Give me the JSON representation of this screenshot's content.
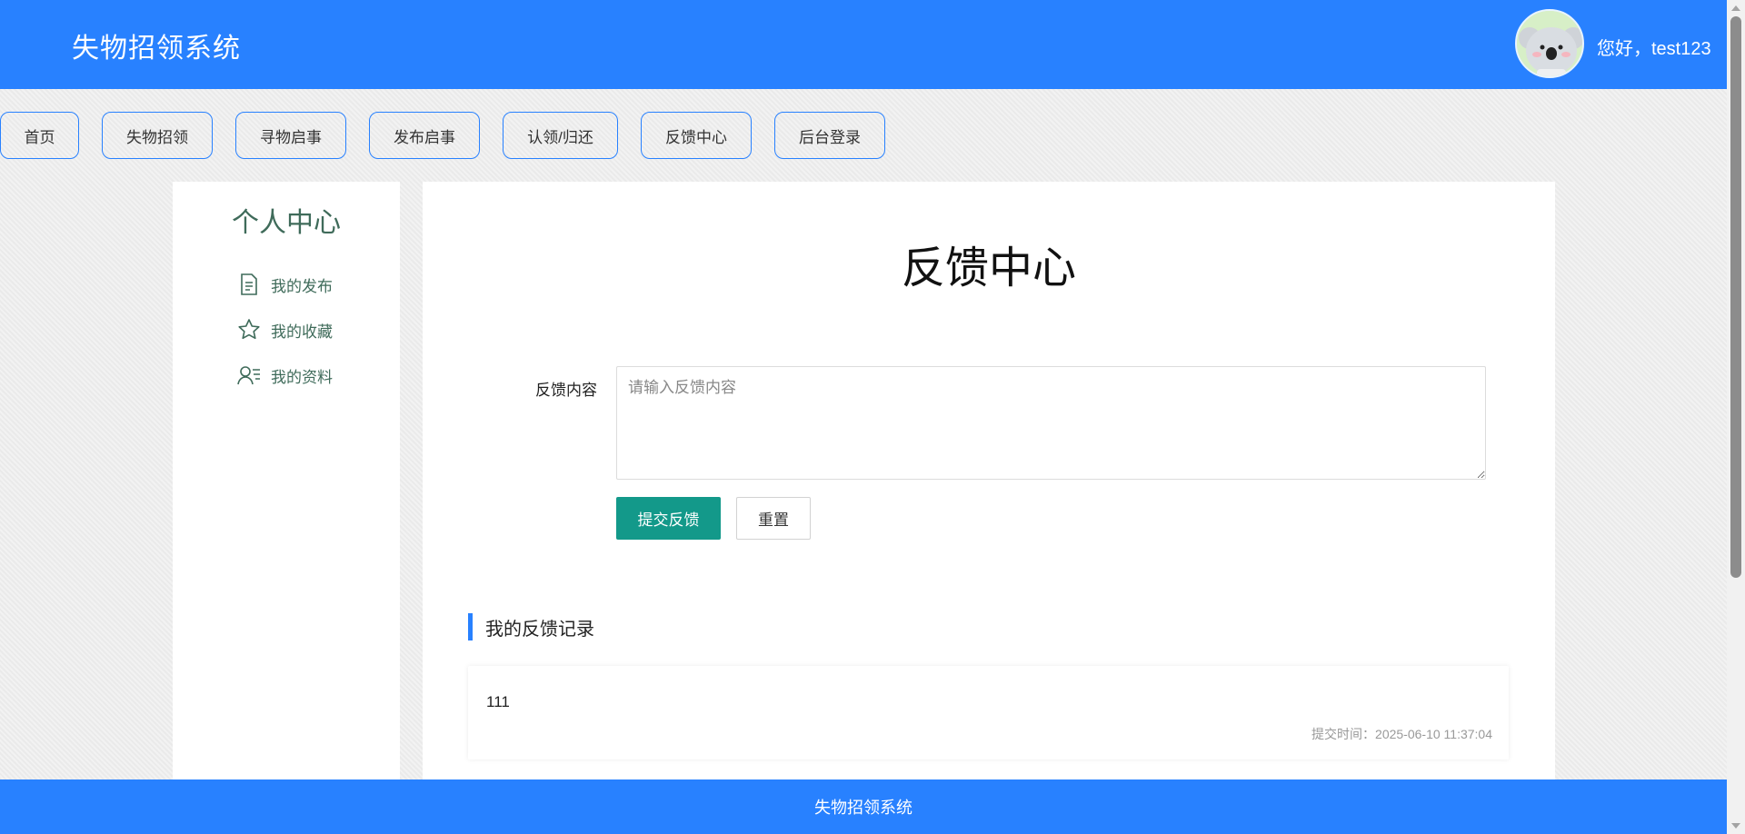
{
  "header": {
    "app_title": "失物招领系统",
    "greeting": "您好，test123"
  },
  "nav": {
    "items": [
      {
        "label": "首页"
      },
      {
        "label": "失物招领"
      },
      {
        "label": "寻物启事"
      },
      {
        "label": "发布启事"
      },
      {
        "label": "认领/归还"
      },
      {
        "label": "反馈中心"
      },
      {
        "label": "后台登录"
      }
    ]
  },
  "sidebar": {
    "title": "个人中心",
    "items": [
      {
        "label": "我的发布",
        "icon": "document-icon"
      },
      {
        "label": "我的收藏",
        "icon": "star-icon"
      },
      {
        "label": "我的资料",
        "icon": "user-card-icon"
      }
    ]
  },
  "main": {
    "page_title": "反馈中心",
    "form_label": "反馈内容",
    "textarea_placeholder": "请输入反馈内容",
    "textarea_value": "",
    "submit_label": "提交反馈",
    "reset_label": "重置",
    "section_title": "我的反馈记录",
    "records": [
      {
        "content": "111",
        "time": "提交时间：2025-06-10 11:37:04"
      }
    ]
  },
  "footer": {
    "text": "失物招领系统"
  },
  "colors": {
    "primary": "#2881ff",
    "submit": "#13998a",
    "sidebar_text": "#3f6b5a"
  }
}
